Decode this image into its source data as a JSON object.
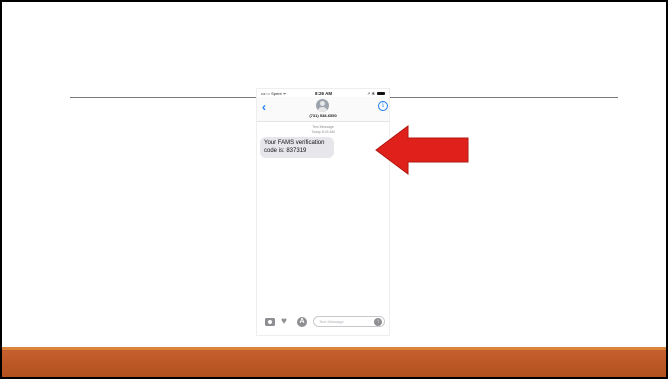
{
  "slide": {
    "colors": {
      "background": "#ffffff",
      "footer": "#c0592a",
      "arrow": "#e0211b"
    }
  },
  "phone": {
    "status_bar": {
      "carrier": "•••○○ Sprint ᯤ",
      "time": "8:26 AM",
      "icons": "↗ ✻"
    },
    "nav": {
      "back_icon": "back-chevron-icon",
      "contact_icon": "person-avatar-icon",
      "contact_number": "(731) 538-6550",
      "info_icon": "info-icon"
    },
    "conversation": {
      "meta_line1": "Text Message",
      "meta_line2": "Today 8:24 AM",
      "message_text": "Your FAMS verification code is: 837319"
    },
    "input_bar": {
      "icons": [
        "camera-icon",
        "heart-digital-touch-icon",
        "app-store-icon",
        "send-arrow-icon"
      ],
      "placeholder": "Text Message"
    }
  }
}
